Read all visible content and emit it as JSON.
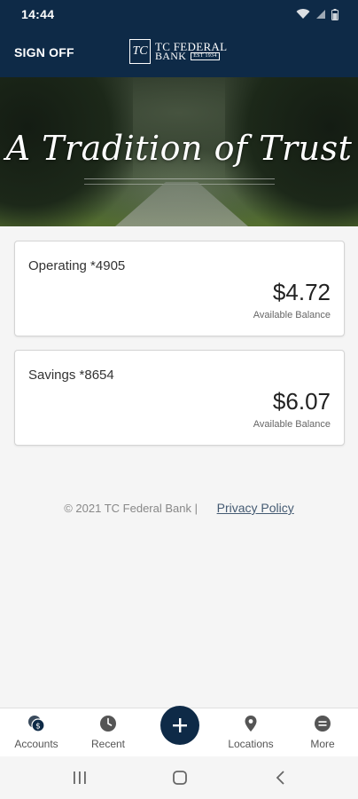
{
  "status_bar": {
    "time": "14:44",
    "icons": [
      "wifi-icon",
      "signal-icon",
      "battery-icon"
    ]
  },
  "header": {
    "sign_off_label": "SIGN OFF",
    "logo_line1": "TC FEDERAL",
    "logo_line2": "BANK",
    "logo_est": "EST 1934",
    "logo_mark": "TC"
  },
  "hero": {
    "title": "A Tradition of Trust"
  },
  "accounts": [
    {
      "name": "Operating *4905",
      "balance": "$4.72",
      "balance_label": "Available Balance"
    },
    {
      "name": "Savings *8654",
      "balance": "$6.07",
      "balance_label": "Available Balance"
    }
  ],
  "footer": {
    "copyright": "© 2021 TC Federal Bank |",
    "privacy_label": "Privacy Policy"
  },
  "bottom_nav": {
    "items": [
      {
        "label": "Accounts",
        "icon": "accounts-icon"
      },
      {
        "label": "Recent",
        "icon": "clock-icon"
      },
      {
        "label": "Locations",
        "icon": "map-pin-icon"
      },
      {
        "label": "More",
        "icon": "more-icon"
      }
    ],
    "add_icon": "plus-icon"
  },
  "system_nav": {
    "icons": [
      "recents-icon",
      "home-icon",
      "back-icon"
    ]
  },
  "colors": {
    "brand_navy": "#0e2a47",
    "background": "#f5f5f5",
    "card": "#ffffff",
    "link": "#445a72"
  }
}
